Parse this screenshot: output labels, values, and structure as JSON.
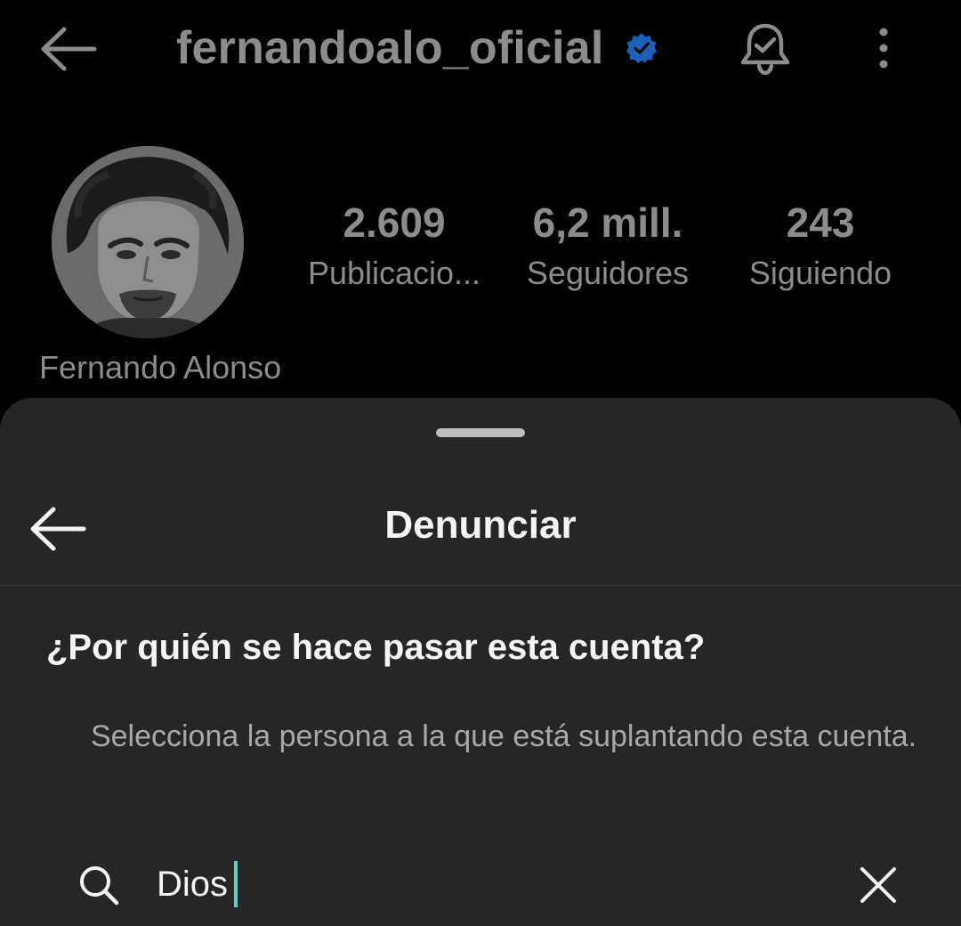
{
  "profile": {
    "username": "fernandoalo_oficial",
    "full_name": "Fernando Alonso",
    "stats": [
      {
        "value": "2.609",
        "label": "Publicacio..."
      },
      {
        "value": "6,2 mill.",
        "label": "Seguidores"
      },
      {
        "value": "243",
        "label": "Siguiendo"
      }
    ],
    "verified_color": "#1877F2"
  },
  "sheet": {
    "title": "Denunciar",
    "question": "¿Por quién se hace pasar esta cuenta?",
    "subtitle": "Selecciona la persona a la que está suplantando esta cuenta.",
    "search": {
      "value": "Dios",
      "icon": "search-icon",
      "clear_icon": "close-icon"
    }
  },
  "colors": {
    "background": "#000000",
    "sheet_background": "#262626",
    "caret": "#5fd0c8"
  }
}
